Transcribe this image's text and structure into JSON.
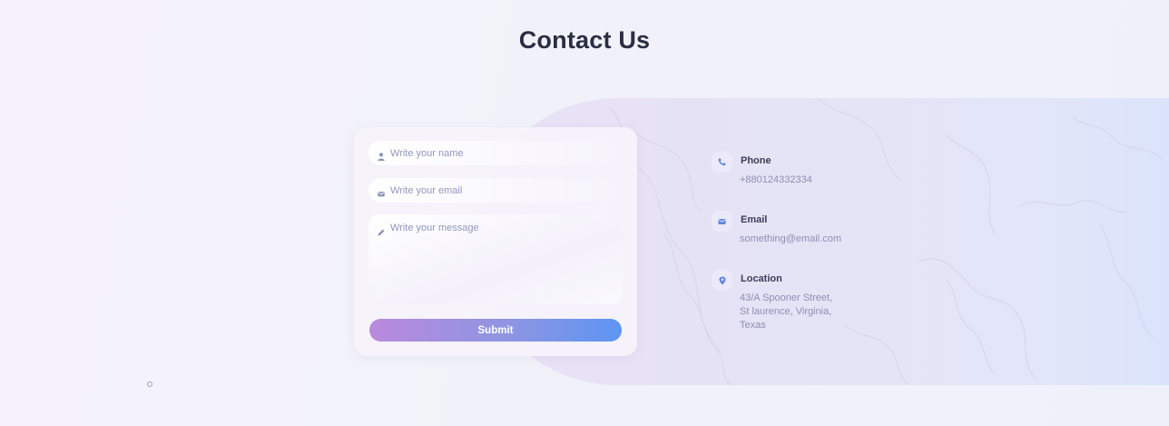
{
  "page": {
    "title": "Contact Us"
  },
  "form": {
    "name_placeholder": "Write your name",
    "email_placeholder": "Write your email",
    "message_placeholder": "Write your message",
    "submit_label": "Submit",
    "icons": [
      "user-icon",
      "envelope-icon",
      "pencil-icon"
    ]
  },
  "contact": {
    "phone": {
      "label": "Phone",
      "value": "+880124332334",
      "icon": "phone-icon"
    },
    "email": {
      "label": "Email",
      "value": "something@email.com",
      "icon": "envelope-icon"
    },
    "location": {
      "label": "Location",
      "lines": [
        "43/A Spooner Street,",
        "St laurence, Virginia,",
        "Texas"
      ],
      "icon": "map-pin-icon"
    }
  },
  "colors": {
    "accent_start": "#b989dd",
    "accent_end": "#5d95f4",
    "title": "#2a2e45",
    "muted_text": "#8b90b4",
    "icon_blue": "#5f86e0"
  }
}
